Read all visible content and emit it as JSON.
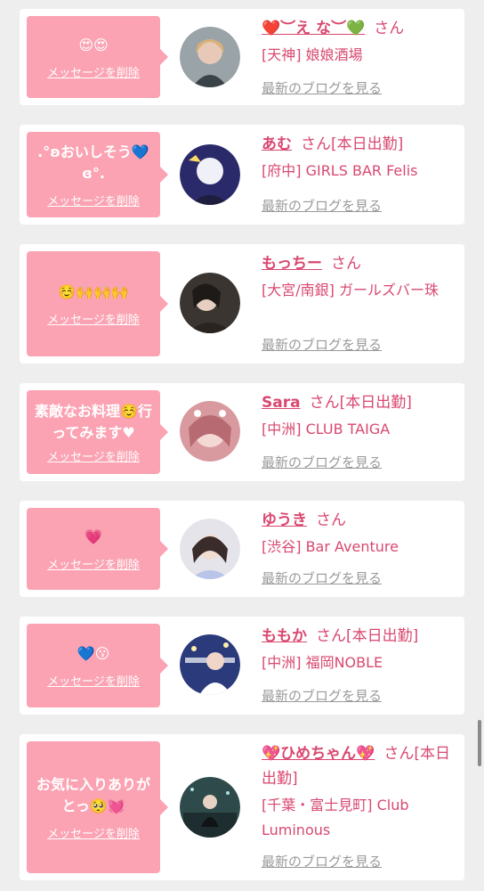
{
  "delete_label": "メッセージを削除",
  "blog_label": "最新のブログを見る",
  "san_label": "さん",
  "items": [
    {
      "message": "😍😍",
      "name": "❤️︶え な︶💚",
      "status": "",
      "shop": "[天神] 娘娘酒場"
    },
    {
      "message": ".°ʚおいしそう💙ɞ°.",
      "name": "あむ",
      "status": "[本日出勤]",
      "shop": "[府中] GIRLS BAR Felis"
    },
    {
      "message": "☺️🙌🙌🙌",
      "name": "もっちー",
      "status": "",
      "shop": "[大宮/南銀] ガールズバー珠"
    },
    {
      "message": "素敵なお料理☺️行ってみます♥",
      "name": "Sara",
      "status": "[本日出勤]",
      "shop": "[中洲] CLUB TAIGA"
    },
    {
      "message": "💗",
      "name": "ゆうき",
      "status": "",
      "shop": "[渋谷] Bar Aventure"
    },
    {
      "message": "💙😗",
      "name": "ももか",
      "status": "[本日出勤]",
      "shop": "[中洲] 福岡NOBLE"
    },
    {
      "message": "お気に入りありがとっ🥺💓",
      "name": "💖ひめちゃん💖",
      "status": "[本日出勤]",
      "shop": "[千葉・富士見町] Club Luminous"
    }
  ]
}
